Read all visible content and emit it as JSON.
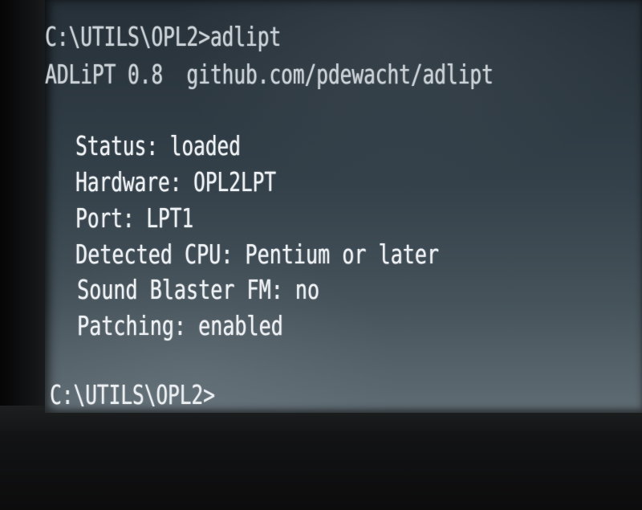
{
  "terminal": {
    "lines": {
      "command": "C:\\UTILS\\OPL2>adlipt",
      "banner": "ADLiPT 0.8  github.com/pdewacht/adlipt",
      "status": "Status: loaded",
      "hardware": "Hardware: OPL2LPT",
      "port": "Port: LPT1",
      "cpu": "Detected CPU: Pentium or later",
      "sound_blaster": "Sound Blaster FM: no",
      "patching": "Patching: enabled",
      "prompt": "C:\\UTILS\\OPL2>"
    }
  }
}
